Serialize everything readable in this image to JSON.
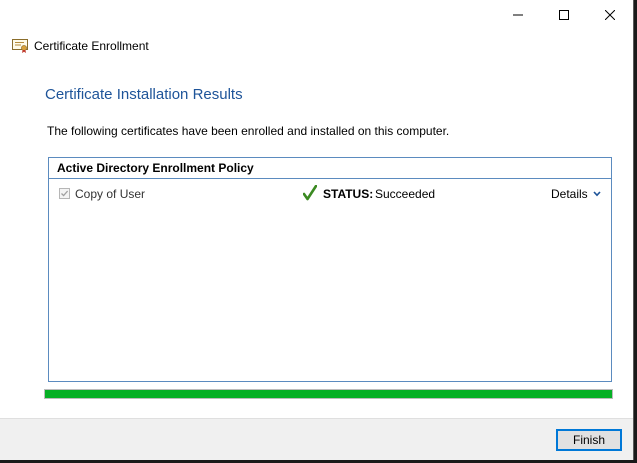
{
  "window": {
    "title": "Certificate Enrollment",
    "icons": {
      "app": "certificate-icon",
      "minimize": "minimize-icon",
      "maximize": "maximize-icon",
      "close": "close-icon"
    }
  },
  "page": {
    "heading": "Certificate Installation Results",
    "intro": "The following certificates have been enrolled and installed on this computer."
  },
  "policy": {
    "name": "Active Directory Enrollment Policy",
    "certificates": [
      {
        "name": "Copy of User",
        "checked": true,
        "status_label": "STATUS:",
        "status_value": "Succeeded",
        "details_label": "Details"
      }
    ]
  },
  "progress": {
    "percent": 100,
    "color": "#06b025"
  },
  "footer": {
    "finish_label": "Finish"
  },
  "colors": {
    "heading": "#1e5499",
    "border": "#5b8bbf",
    "accent": "#0078d7"
  }
}
